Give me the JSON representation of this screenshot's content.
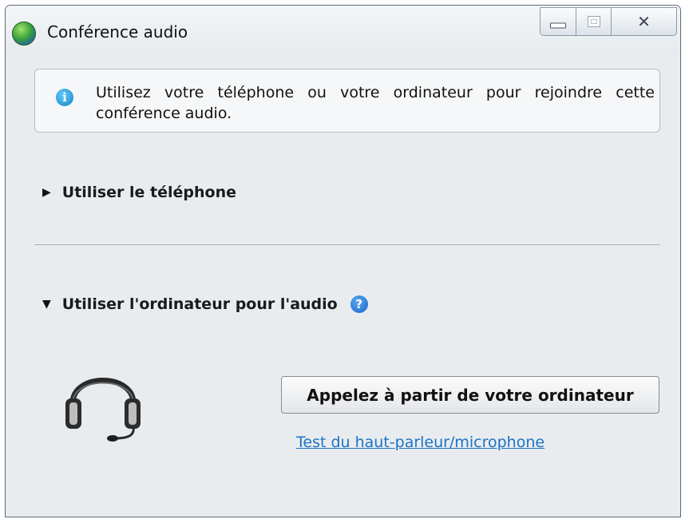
{
  "window": {
    "title": "Conférence audio",
    "controls": {
      "minimize": "minimize",
      "maximize": "maximize",
      "close": "✕"
    }
  },
  "info": {
    "message": "Utilisez votre téléphone ou votre ordinateur pour rejoindre cette conférence audio."
  },
  "sections": {
    "phone": {
      "label": "Utiliser le téléphone",
      "expanded": false,
      "toggle": "▶"
    },
    "computer": {
      "label": "Utiliser l'ordinateur pour l'audio",
      "expanded": true,
      "toggle": "▼",
      "help": "?"
    }
  },
  "actions": {
    "call_button": "Appelez à partir de votre ordinateur",
    "test_link": "Test du haut-parleur/microphone"
  },
  "icons": {
    "app": "globe-icon",
    "info": "info-icon",
    "help": "help-icon",
    "headset": "headset-icon"
  },
  "colors": {
    "link": "#1a73c7",
    "window_bg": "#e9ecef",
    "help_icon": "#1565c8",
    "info_icon": "#1a86c9"
  }
}
